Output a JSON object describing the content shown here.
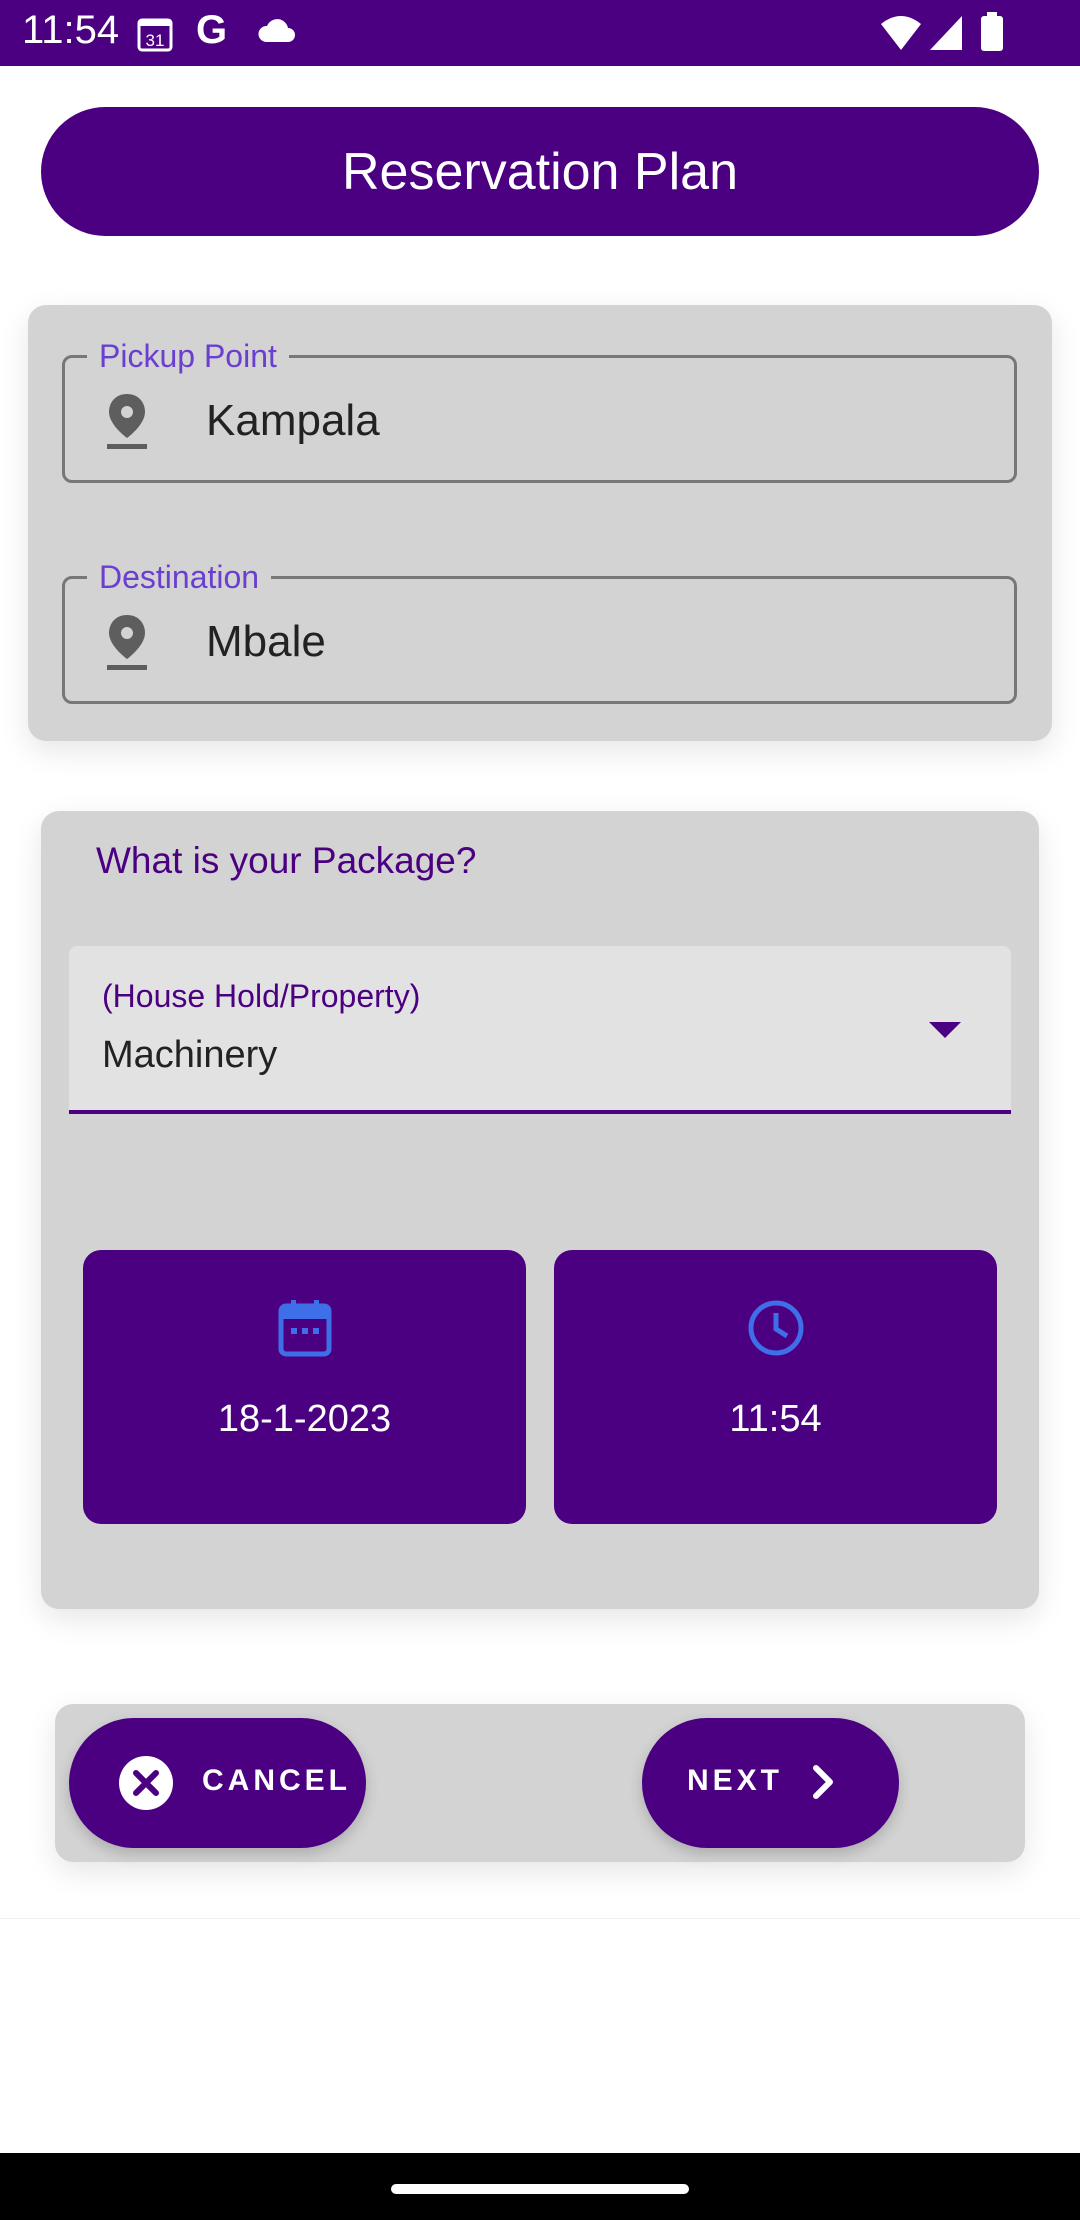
{
  "status_bar": {
    "time": "11:54",
    "calendar_day": "31",
    "g_letter": "G"
  },
  "header": {
    "title": "Reservation Plan"
  },
  "route": {
    "pickup": {
      "label": "Pickup Point",
      "value": "Kampala"
    },
    "destination": {
      "label": "Destination",
      "value": "Mbale"
    }
  },
  "package": {
    "question": "What is your Package?",
    "select_label": "(House Hold/Property)",
    "select_value": "Machinery"
  },
  "schedule": {
    "date": "18-1-2023",
    "time": "11:54"
  },
  "actions": {
    "cancel_label": "CANCEL",
    "next_label": "NEXT"
  },
  "colors": {
    "primary": "#4b0082",
    "card": "#d3d3d3",
    "accent_icon": "#3f6fe8",
    "label": "#6a3fd0"
  },
  "icons": [
    "calendar-status-icon",
    "google-icon",
    "cloud-icon",
    "wifi-icon",
    "signal-icon",
    "battery-icon",
    "location-pin-icon",
    "dropdown-arrow-icon",
    "calendar-icon",
    "clock-icon",
    "close-circle-icon",
    "chevron-right-icon"
  ]
}
